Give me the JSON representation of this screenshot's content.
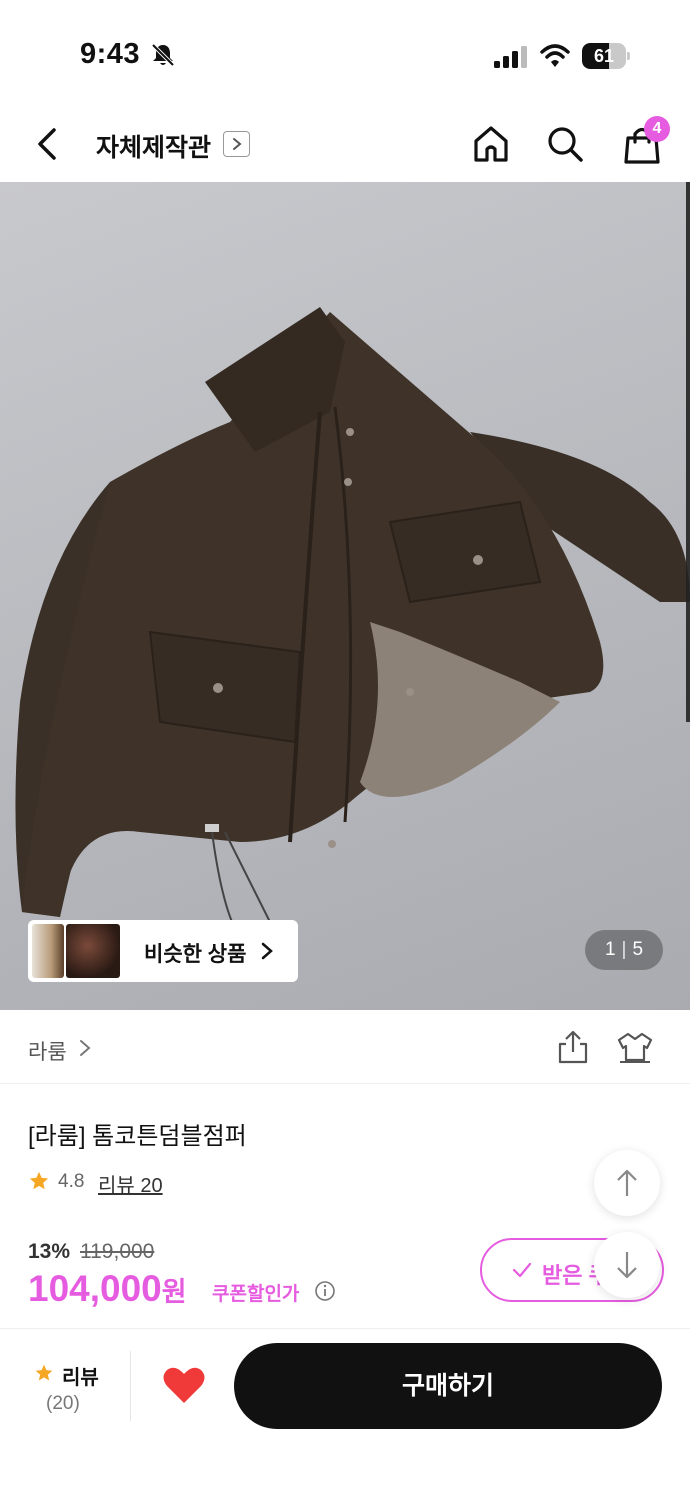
{
  "status_bar": {
    "time": "9:43",
    "battery": "61",
    "battery_level": 0.61,
    "icons": [
      "bell-slash-icon",
      "signal-icon",
      "wifi-icon",
      "battery-icon"
    ]
  },
  "nav": {
    "store_title": "자체제작관",
    "cart_count": "4",
    "icons": [
      "back-icon",
      "chevron-right-icon",
      "home-icon",
      "search-icon",
      "shopping-bag-icon"
    ]
  },
  "hero": {
    "similar_label": "비슷한 상품",
    "page_current": "1",
    "page_total": "5"
  },
  "brand": {
    "name": "라룸",
    "icons": [
      "share-icon",
      "fitting-icon"
    ]
  },
  "product": {
    "name": "[라룸] 톰코튼덤블점퍼",
    "rating": "4.8",
    "review_link": "리뷰 20",
    "discount_rate": "13%",
    "original_price": "119,000",
    "sale_price": "104,000",
    "sale_unit": "원",
    "coupon_label": "쿠폰할인가",
    "coupon_button": "받은 쿠"
  },
  "bottom_bar": {
    "review_label": "리뷰",
    "review_count": "(20)",
    "buy_label": "구매하기"
  },
  "colors": {
    "accent": "#e65ce0",
    "star": "#f5a623",
    "heart": "#f03a3a",
    "buy_button": "#111111"
  }
}
